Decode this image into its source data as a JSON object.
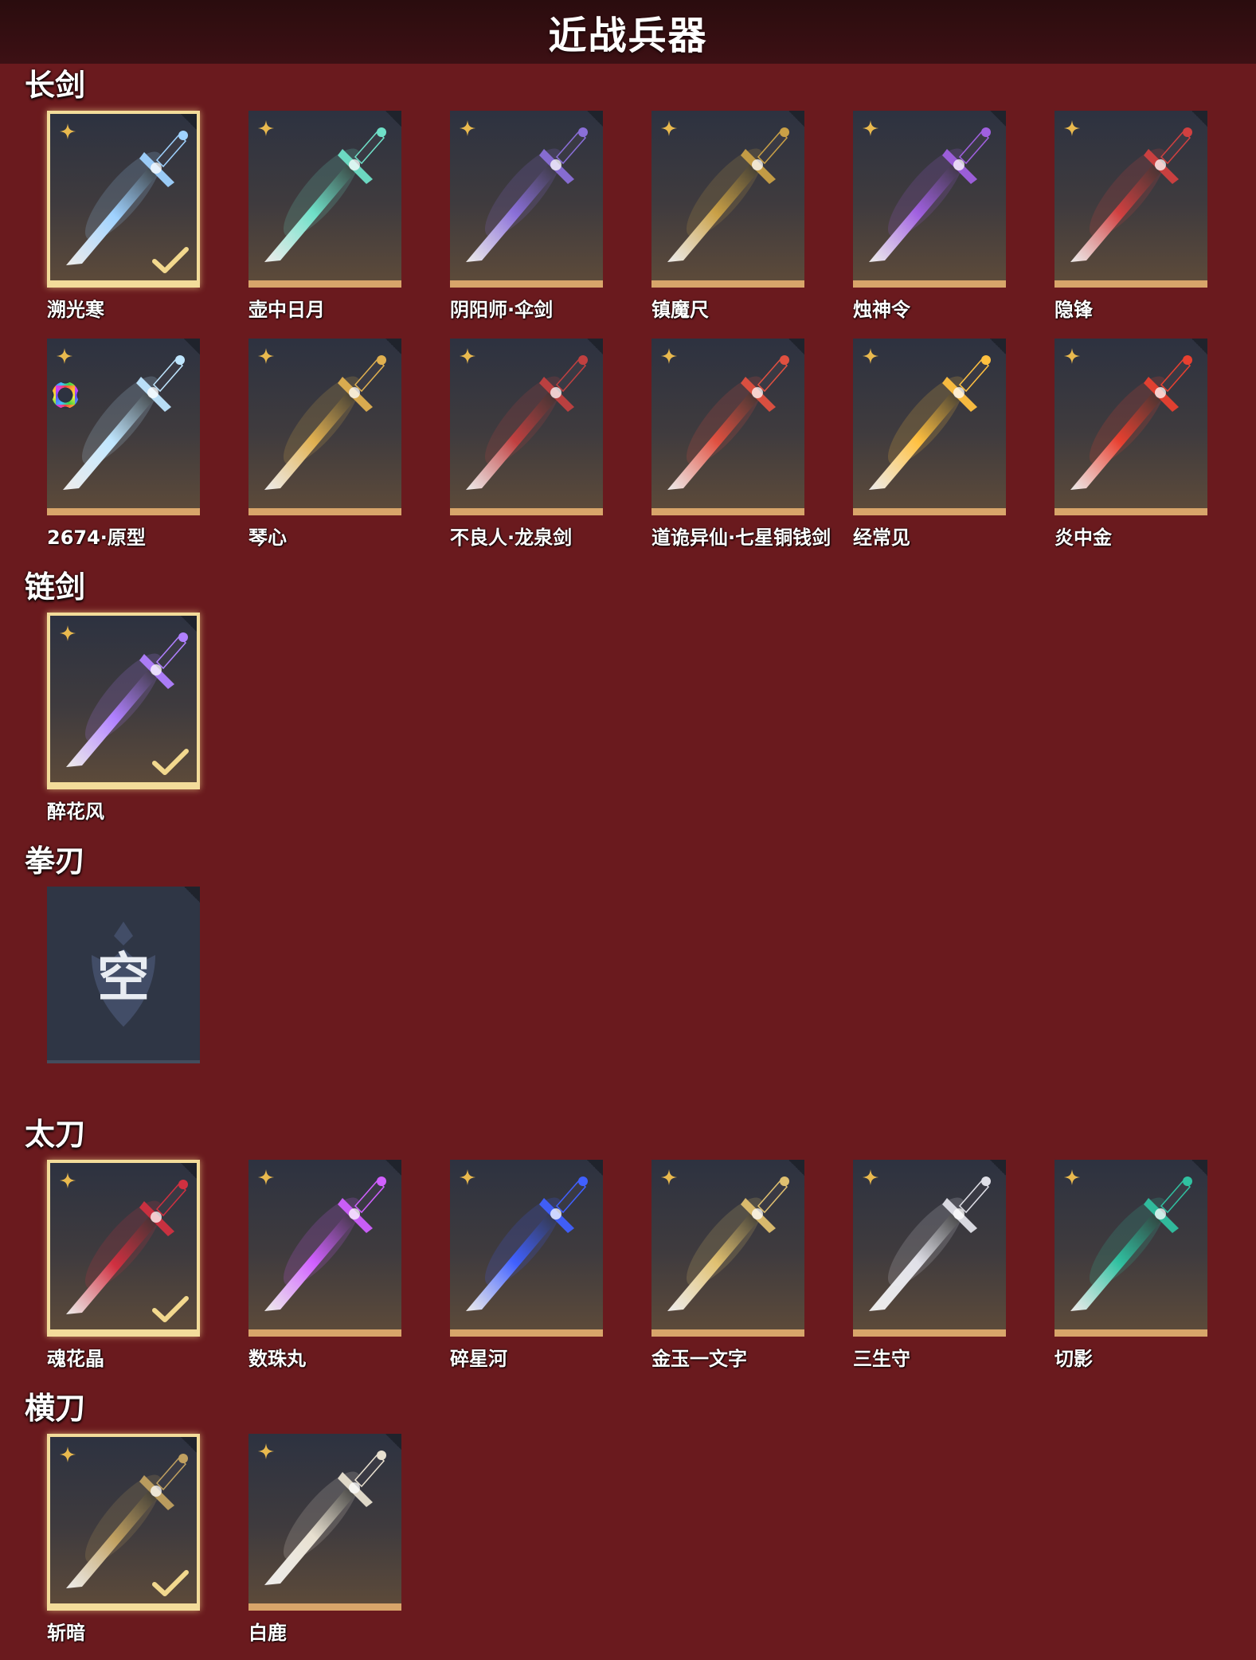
{
  "header": {
    "title": "近战兵器"
  },
  "sections": [
    {
      "title": "长剑",
      "items": [
        {
          "name": "溯光寒",
          "selected": true,
          "color": "#9fd2ff"
        },
        {
          "name": "壶中日月",
          "selected": false,
          "color": "#6fe0c8"
        },
        {
          "name": "阴阳师·伞剑",
          "selected": false,
          "color": "#8a6fd8"
        },
        {
          "name": "镇魔尺",
          "selected": false,
          "color": "#c9a046"
        },
        {
          "name": "烛神令",
          "selected": false,
          "color": "#a060e0"
        },
        {
          "name": "隐锋",
          "selected": false,
          "color": "#d04040"
        },
        {
          "name": "2674·原型",
          "selected": false,
          "color": "#bfe6ff",
          "badge": "color-ring-icon"
        },
        {
          "name": "琴心",
          "selected": false,
          "color": "#e0b050"
        },
        {
          "name": "不良人·龙泉剑",
          "selected": false,
          "color": "#c04040"
        },
        {
          "name": "道诡异仙·七星铜钱剑",
          "selected": false,
          "color": "#e05040"
        },
        {
          "name": "经常见",
          "selected": false,
          "color": "#ffc040"
        },
        {
          "name": "炎中金",
          "selected": false,
          "color": "#e84030"
        }
      ]
    },
    {
      "title": "链剑",
      "items": [
        {
          "name": "醉花风",
          "selected": true,
          "color": "#b080ff"
        }
      ]
    },
    {
      "title": "拳刃",
      "items": [
        {
          "name": "",
          "selected": false,
          "empty": true,
          "glyph": "空"
        }
      ]
    },
    {
      "title": "太刀",
      "items": [
        {
          "name": "魂花晶",
          "selected": true,
          "color": "#d03040"
        },
        {
          "name": "数珠丸",
          "selected": false,
          "color": "#d060ff"
        },
        {
          "name": "碎星河",
          "selected": false,
          "color": "#4060ff"
        },
        {
          "name": "金玉一文字",
          "selected": false,
          "color": "#e0c070"
        },
        {
          "name": "三生守",
          "selected": false,
          "color": "#e0e0e8"
        },
        {
          "name": "切影",
          "selected": false,
          "color": "#30c0a0"
        }
      ]
    },
    {
      "title": "横刀",
      "items": [
        {
          "name": "斩暗",
          "selected": true,
          "color": "#c0a060"
        },
        {
          "name": "白鹿",
          "selected": false,
          "color": "#e8e0d0"
        }
      ]
    }
  ]
}
